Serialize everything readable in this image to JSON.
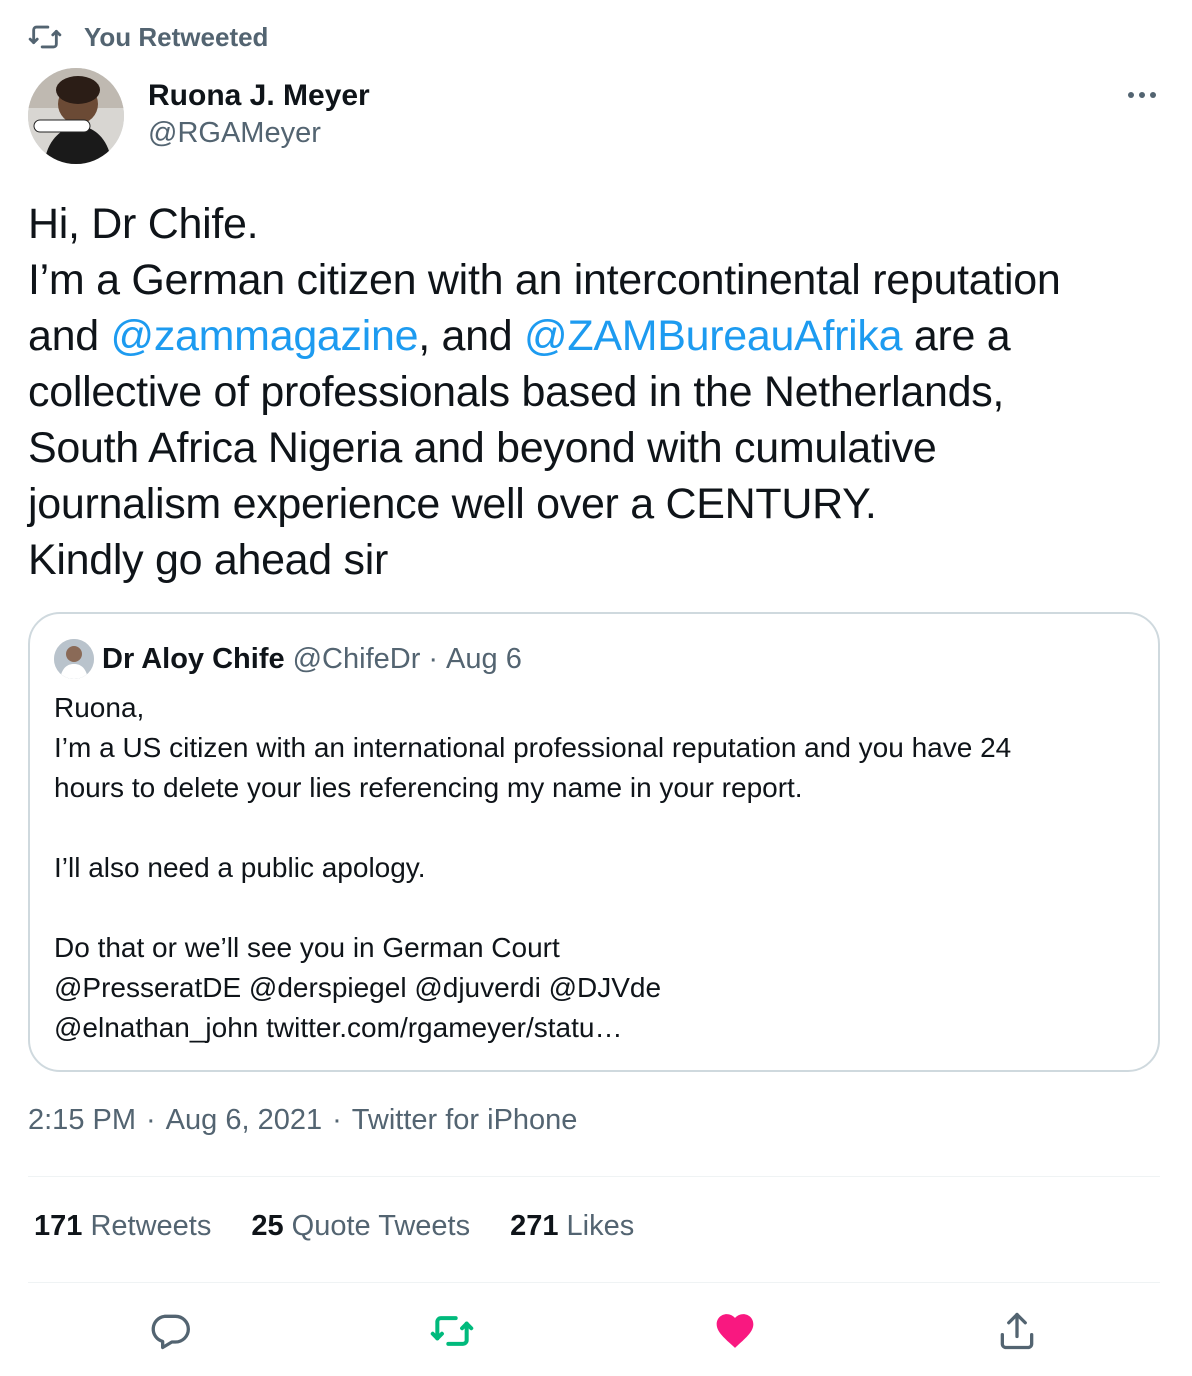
{
  "retweet_context": {
    "text": "You Retweeted"
  },
  "author": {
    "name": "Ruona J. Meyer",
    "handle": "@RGAMeyer"
  },
  "tweet": {
    "line1": "Hi, Dr Chife.",
    "line2": "I’m a German citizen with an intercontinental reputation",
    "line3_pre": "and ",
    "mention1": "@zammagazine",
    "line3_mid": ", and ",
    "mention2": "@ZAMBureauAfrika",
    "line3_post": " are a",
    "line4": "collective of professionals based in the Netherlands,",
    "line5": "South Africa Nigeria and beyond with cumulative",
    "line6": "journalism experience well over a CENTURY.",
    "line7": "Kindly go ahead sir"
  },
  "quote": {
    "name": "Dr Aloy Chife",
    "handle": "@ChifeDr",
    "date": "Aug 6",
    "lines": [
      "Ruona,",
      "I’m a US citizen with an international professional reputation and you have 24",
      "hours to delete your lies referencing my name in your report.",
      "",
      "I’ll also need a public apology.",
      "",
      "Do that or we’ll see you in German Court",
      "@PresseratDE @derspiegel @djuverdi @DJVde",
      "@elnathan_john twitter.com/rgameyer/statu…"
    ]
  },
  "meta": {
    "time": "2:15 PM",
    "date": "Aug 6, 2021",
    "source": "Twitter for iPhone"
  },
  "stats": {
    "retweets_count": "171",
    "retweets_label": "Retweets",
    "quotes_count": "25",
    "quotes_label": "Quote Tweets",
    "likes_count": "271",
    "likes_label": "Likes"
  },
  "colors": {
    "text": "#0f1419",
    "secondary": "#536471",
    "accent": "#1d9bf0",
    "retweet_green": "#00ba7c",
    "like_pink": "#f91880",
    "border": "#cfd9de"
  },
  "icons": {
    "retweet_context": "retweet-icon",
    "more": "more-icon",
    "reply": "reply-icon",
    "retweet": "retweet-icon",
    "like": "heart-icon",
    "share": "share-icon"
  }
}
